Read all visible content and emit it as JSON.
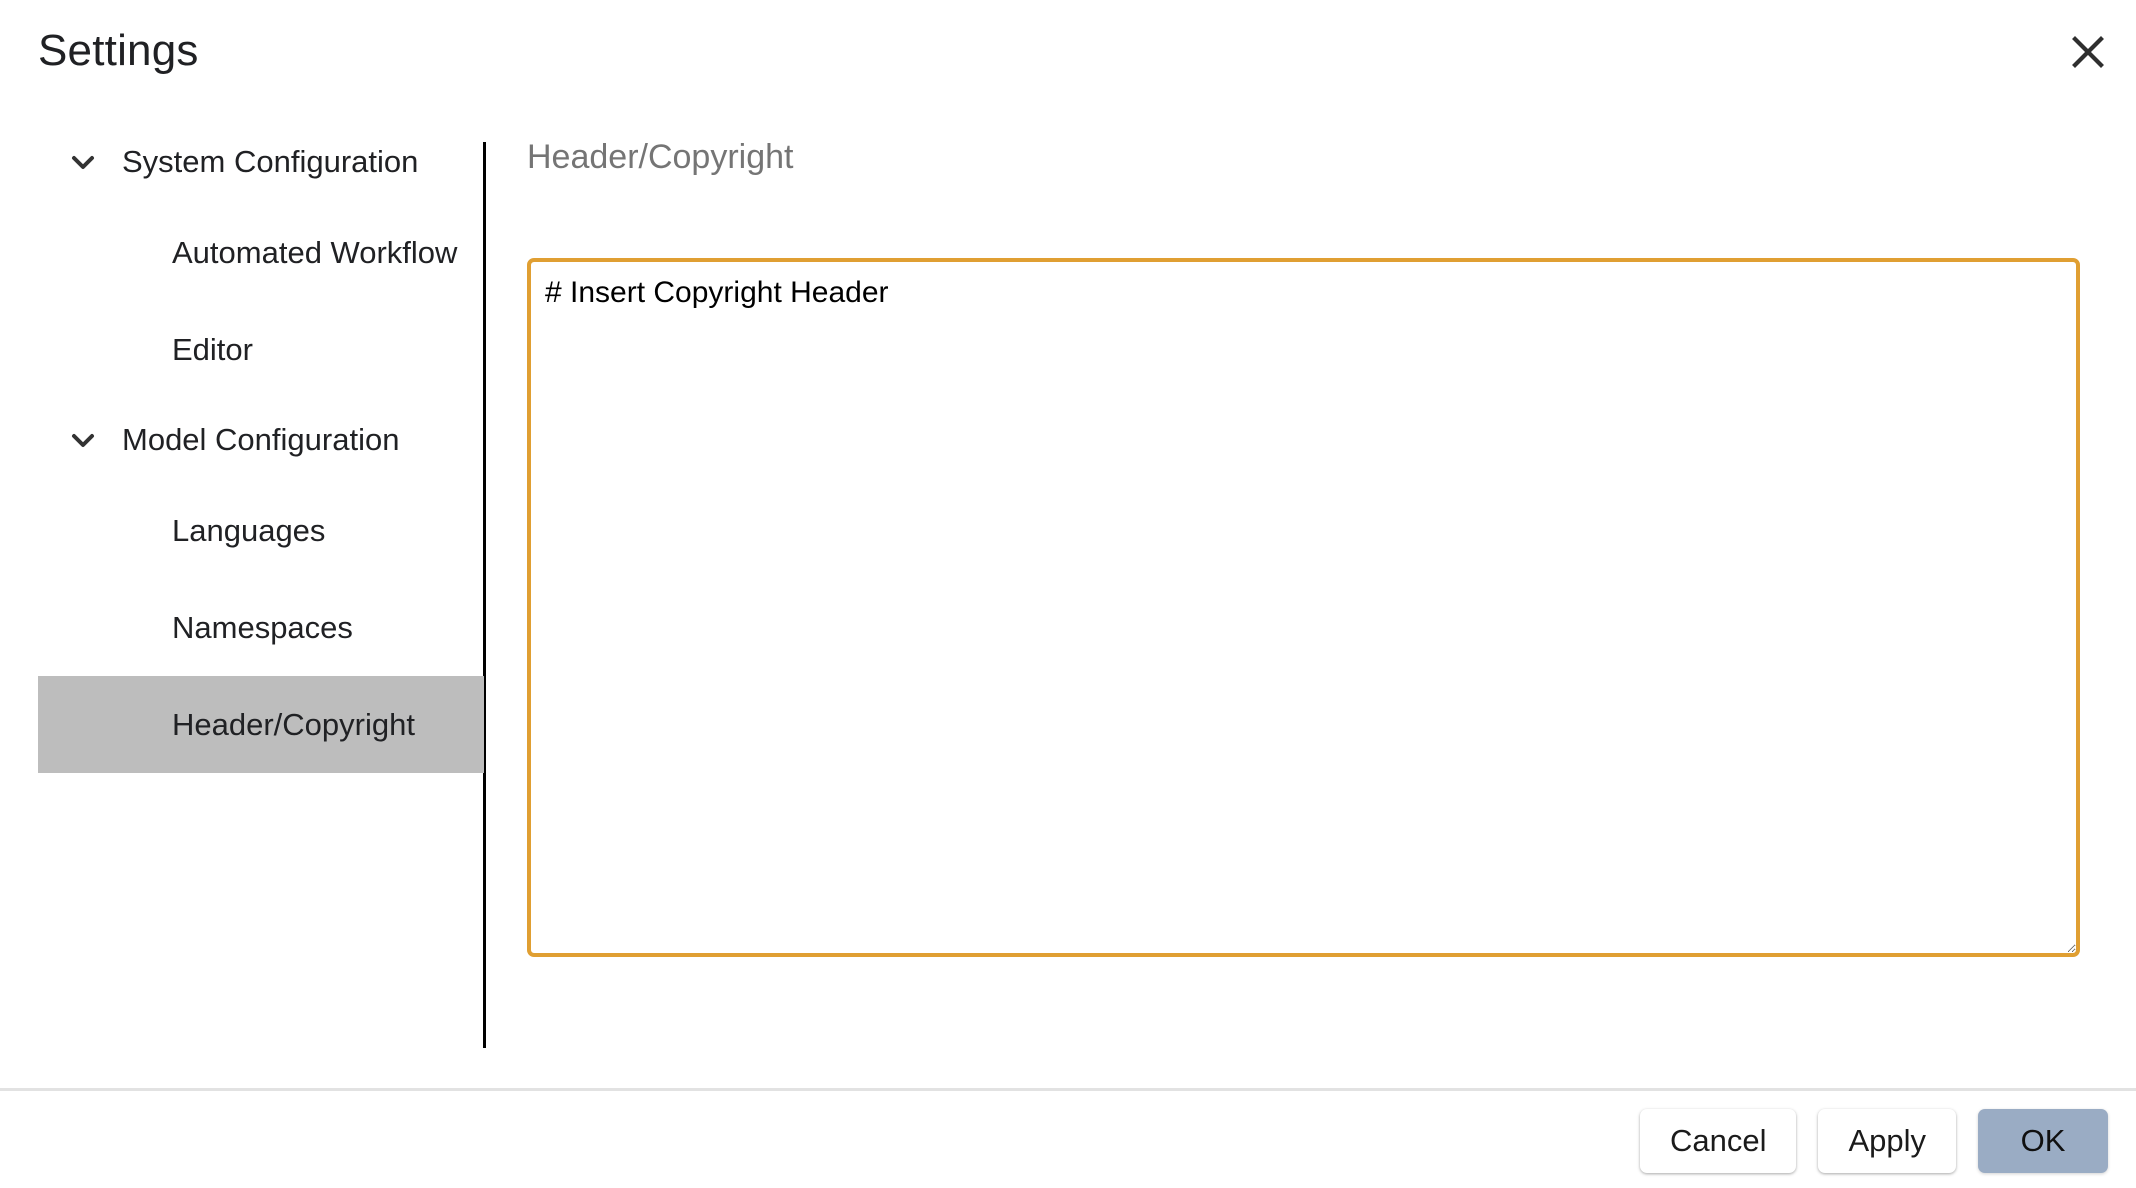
{
  "dialog": {
    "title": "Settings",
    "close_icon": "close-icon"
  },
  "sidebar": {
    "groups": [
      {
        "label": "System Configuration",
        "icon": "chevron-down-icon",
        "expanded": true,
        "items": [
          {
            "label": "Automated Workflow",
            "selected": false
          },
          {
            "label": "Editor",
            "selected": false
          }
        ]
      },
      {
        "label": "Model Configuration",
        "icon": "chevron-down-icon",
        "expanded": true,
        "items": [
          {
            "label": "Languages",
            "selected": false
          },
          {
            "label": "Namespaces",
            "selected": false
          },
          {
            "label": "Header/Copyright",
            "selected": true
          }
        ]
      }
    ]
  },
  "content": {
    "panel_title": "Header/Copyright",
    "textarea": {
      "value": "# Insert Copyright Header",
      "placeholder": ""
    }
  },
  "footer": {
    "buttons": [
      {
        "label": "Cancel",
        "style": "secondary"
      },
      {
        "label": "Apply",
        "style": "secondary"
      },
      {
        "label": "OK",
        "style": "primary"
      }
    ]
  },
  "colors": {
    "selection_background": "#bdbdbd",
    "focus_border": "#e09f32",
    "primary_button": "#9aacc4",
    "panel_title_text": "#757575",
    "divider": "#e2e2e2",
    "pane_divider": "#000000"
  }
}
